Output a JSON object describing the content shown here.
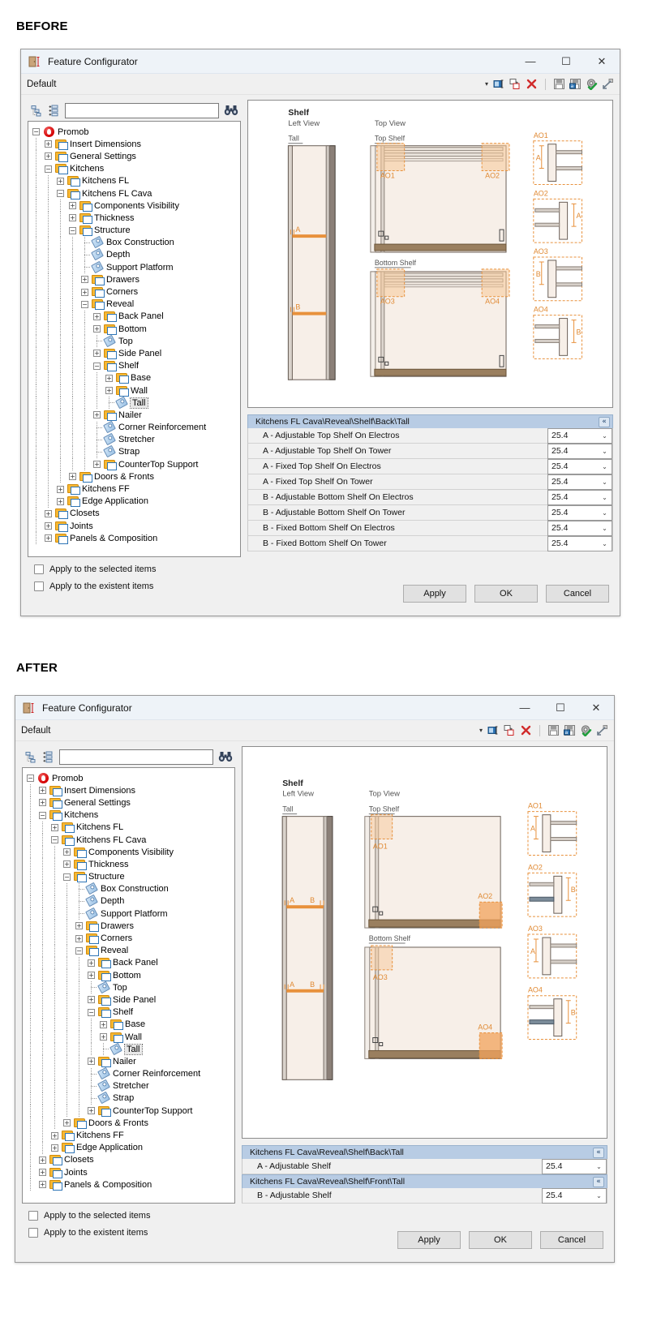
{
  "page": {
    "before_label": "BEFORE",
    "after_label": "AFTER"
  },
  "window": {
    "title": "Feature Configurator",
    "title_icon": "feature-configurator-icon",
    "minimize": "—",
    "maximize": "☐",
    "close": "✕"
  },
  "toolbar": {
    "profile": "Default",
    "caret": "▾",
    "icons": [
      "rename-icon",
      "duplicate-icon",
      "delete-icon",
      "save-icon",
      "save-as-icon",
      "apply-settings-icon",
      "expand-icon"
    ]
  },
  "tree_toolbar": {
    "collapse_all_icon": "collapse-tree-icon",
    "expand_all_icon": "expand-tree-icon",
    "search_value": "",
    "search_placeholder": "",
    "find_icon": "binoculars-icon"
  },
  "tree_before": [
    {
      "depth": 0,
      "label": "Promob",
      "icon": "promob",
      "state": "minus"
    },
    {
      "depth": 1,
      "label": "Insert Dimensions",
      "icon": "folder",
      "state": "plus"
    },
    {
      "depth": 1,
      "label": "General Settings",
      "icon": "folder",
      "state": "plus"
    },
    {
      "depth": 1,
      "label": "Kitchens",
      "icon": "folder",
      "state": "minus"
    },
    {
      "depth": 2,
      "label": "Kitchens FL",
      "icon": "folder",
      "state": "plus"
    },
    {
      "depth": 2,
      "label": "Kitchens FL Cava",
      "icon": "folder",
      "state": "minus"
    },
    {
      "depth": 3,
      "label": "Components Visibility",
      "icon": "folder",
      "state": "plus"
    },
    {
      "depth": 3,
      "label": "Thickness",
      "icon": "folder",
      "state": "plus"
    },
    {
      "depth": 3,
      "label": "Structure",
      "icon": "folder",
      "state": "minus"
    },
    {
      "depth": 4,
      "label": "Box Construction",
      "icon": "tag",
      "state": "none"
    },
    {
      "depth": 4,
      "label": "Depth",
      "icon": "tag",
      "state": "none"
    },
    {
      "depth": 4,
      "label": "Support Platform",
      "icon": "tag",
      "state": "none"
    },
    {
      "depth": 4,
      "label": "Drawers",
      "icon": "folder",
      "state": "plus"
    },
    {
      "depth": 4,
      "label": "Corners",
      "icon": "folder",
      "state": "plus"
    },
    {
      "depth": 4,
      "label": "Reveal",
      "icon": "folder",
      "state": "minus"
    },
    {
      "depth": 5,
      "label": "Back Panel",
      "icon": "folder",
      "state": "plus"
    },
    {
      "depth": 5,
      "label": "Bottom",
      "icon": "folder",
      "state": "plus"
    },
    {
      "depth": 5,
      "label": "Top",
      "icon": "tag",
      "state": "none"
    },
    {
      "depth": 5,
      "label": "Side Panel",
      "icon": "folder",
      "state": "plus"
    },
    {
      "depth": 5,
      "label": "Shelf",
      "icon": "folder",
      "state": "minus"
    },
    {
      "depth": 6,
      "label": "Base",
      "icon": "folder",
      "state": "plus"
    },
    {
      "depth": 6,
      "label": "Wall",
      "icon": "folder",
      "state": "plus"
    },
    {
      "depth": 6,
      "label": "Tall",
      "icon": "tag",
      "state": "none",
      "selected": true
    },
    {
      "depth": 5,
      "label": "Nailer",
      "icon": "folder",
      "state": "plus"
    },
    {
      "depth": 5,
      "label": "Corner Reinforcement",
      "icon": "tag",
      "state": "none"
    },
    {
      "depth": 5,
      "label": "Stretcher",
      "icon": "tag",
      "state": "none"
    },
    {
      "depth": 5,
      "label": "Strap",
      "icon": "tag",
      "state": "none"
    },
    {
      "depth": 5,
      "label": "CounterTop Support",
      "icon": "folder",
      "state": "plus"
    },
    {
      "depth": 3,
      "label": "Doors & Fronts",
      "icon": "folder",
      "state": "plus"
    },
    {
      "depth": 2,
      "label": "Kitchens FF",
      "icon": "folder",
      "state": "plus"
    },
    {
      "depth": 2,
      "label": "Edge Application",
      "icon": "folder",
      "state": "plus"
    },
    {
      "depth": 1,
      "label": "Closets",
      "icon": "folder",
      "state": "plus"
    },
    {
      "depth": 1,
      "label": "Joints",
      "icon": "folder",
      "state": "plus"
    },
    {
      "depth": 1,
      "label": "Panels & Composition",
      "icon": "folder",
      "state": "plus"
    }
  ],
  "drawing": {
    "title": "Shelf",
    "left_view": "Left View",
    "tall": "Tall",
    "top_view": "Top View",
    "top_shelf": "Top Shelf",
    "bottom_shelf": "Bottom Shelf",
    "callouts": [
      "AO1",
      "AO2",
      "AO3",
      "AO4"
    ],
    "dim_a": "A",
    "dim_b": "B",
    "detail_dims": [
      "A",
      "A",
      "B",
      "B"
    ],
    "accent_color": "#e8913c",
    "panel_fill": "#f7efe8"
  },
  "grid_before": {
    "groups": [
      {
        "header": "Kitchens FL Cava\\Reveal\\Shelf\\Back\\Tall",
        "collapse_icon": "«",
        "rows": [
          {
            "name": "A - Adjustable Top Shelf On Electros",
            "value": "25.4"
          },
          {
            "name": "A - Adjustable Top Shelf On Tower",
            "value": "25.4"
          },
          {
            "name": "A - Fixed Top Shelf On Electros",
            "value": "25.4"
          },
          {
            "name": "A - Fixed Top Shelf On Tower",
            "value": "25.4"
          },
          {
            "name": "B - Adjustable Bottom Shelf On Electros",
            "value": "25.4"
          },
          {
            "name": "B - Adjustable Bottom Shelf On Tower",
            "value": "25.4"
          },
          {
            "name": "B - Fixed Bottom Shelf On Electros",
            "value": "25.4"
          },
          {
            "name": "B - Fixed Bottom Shelf On Tower",
            "value": "25.4"
          }
        ]
      }
    ]
  },
  "grid_after": {
    "groups": [
      {
        "header": "Kitchens FL Cava\\Reveal\\Shelf\\Back\\Tall",
        "collapse_icon": "«",
        "rows": [
          {
            "name": "A - Adjustable Shelf",
            "value": "25.4"
          }
        ]
      },
      {
        "header": "Kitchens FL Cava\\Reveal\\Shelf\\Front\\Tall",
        "collapse_icon": "«",
        "rows": [
          {
            "name": "B - Adjustable Shelf",
            "value": "25.4"
          }
        ]
      }
    ]
  },
  "options": {
    "apply_selected": "Apply to the selected items",
    "apply_existent": "Apply to the existent items"
  },
  "buttons": {
    "apply": "Apply",
    "ok": "OK",
    "cancel": "Cancel"
  },
  "dropdown_caret": "⌄"
}
